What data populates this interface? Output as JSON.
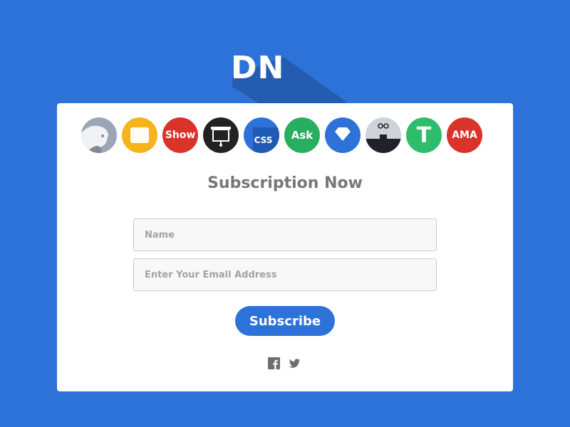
{
  "logo": {
    "text": "DN"
  },
  "icons": [
    {
      "name": "profile-icon",
      "color": "#9aa6b6"
    },
    {
      "name": "window-icon",
      "color": "#f5b419"
    },
    {
      "name": "show-icon",
      "label": "Show",
      "color": "#d9332a"
    },
    {
      "name": "screen-icon",
      "color": "#222222"
    },
    {
      "name": "css-icon",
      "label": "CSS",
      "color": "#2d72d9"
    },
    {
      "name": "ask-icon",
      "label": "Ask",
      "color": "#27ae60"
    },
    {
      "name": "diamond-icon",
      "color": "#2d72d9"
    },
    {
      "name": "glasses-person-icon",
      "color": "#cfd3d8"
    },
    {
      "name": "t-icon",
      "label": "T",
      "color": "#2ebd6a"
    },
    {
      "name": "ama-icon",
      "label": "AMA",
      "color": "#d9332a"
    }
  ],
  "form": {
    "title": "Subscription Now",
    "name_placeholder": "Name",
    "email_placeholder": "Enter Your Email Address",
    "submit_label": "Subscribe"
  },
  "social": [
    "facebook-icon",
    "twitter-icon"
  ]
}
